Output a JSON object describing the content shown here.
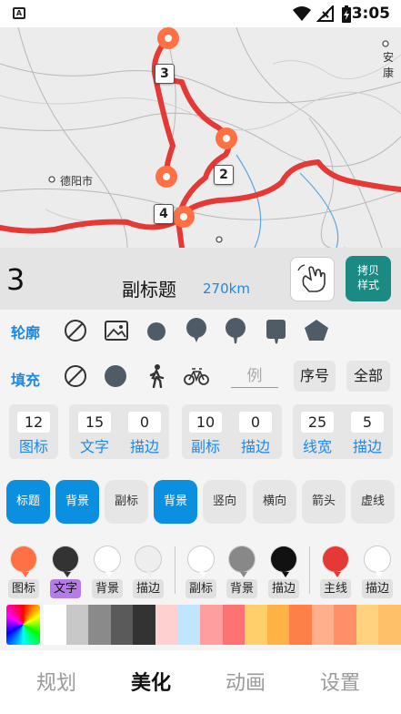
{
  "status_bar": {
    "time": "3:05",
    "app_icon": "A"
  },
  "map": {
    "city_labels": [
      "德阳市",
      "安康"
    ],
    "waypoint_numbers": [
      "3",
      "2",
      "4"
    ],
    "route_color": "#e53935",
    "marker_color": "#ff7043"
  },
  "info": {
    "sequence": "3",
    "subtitle": "副标题",
    "distance": "270km",
    "copy_button_line1": "拷贝",
    "copy_button_line2": "样式"
  },
  "outline": {
    "label": "轮廓"
  },
  "fill": {
    "label": "填充",
    "example_placeholder": "例",
    "index_button": "序号",
    "all_button": "全部"
  },
  "numbers": {
    "icon": {
      "value": "12",
      "label": "图标"
    },
    "text": {
      "value": "15",
      "label": "文字"
    },
    "text_stroke": {
      "value": "0",
      "label": "描边"
    },
    "subtitle": {
      "value": "10",
      "label": "副标"
    },
    "subtitle_stroke": {
      "value": "0",
      "label": "描边"
    },
    "line_width": {
      "value": "25",
      "label": "线宽"
    },
    "line_stroke": {
      "value": "5",
      "label": "描边"
    }
  },
  "toggles": [
    "标题",
    "背景",
    "副标",
    "背景",
    "竖向",
    "横向",
    "箭头",
    "虚线"
  ],
  "swatches": [
    {
      "label": "图标",
      "color": "#ff7043"
    },
    {
      "label": "文字",
      "color": "#333333"
    },
    {
      "label": "背景",
      "color": "#ffffff"
    },
    {
      "label": "描边",
      "color": "#eeeeee"
    },
    {
      "label": "副标",
      "color": "#ffffff"
    },
    {
      "label": "背景",
      "color": "#888888"
    },
    {
      "label": "描边",
      "color": "#111111"
    },
    {
      "label": "主线",
      "color": "#e53935"
    },
    {
      "label": "描边",
      "color": "#ffffff"
    }
  ],
  "palette": [
    "#ffffff",
    "#c8c8c8",
    "#8a8a8a",
    "#5a5a5a",
    "#333333",
    "#ffd0d0",
    "#c0e6ff",
    "#ff9e9e",
    "#ff7272",
    "#ffcf6a",
    "#ffb347",
    "#ff7f47",
    "#ffb08a",
    "#ff8f66",
    "#ffd280",
    "#ffc06a"
  ],
  "bottom_tabs": [
    "规划",
    "美化",
    "动画",
    "设置"
  ],
  "active_tab": "美化"
}
